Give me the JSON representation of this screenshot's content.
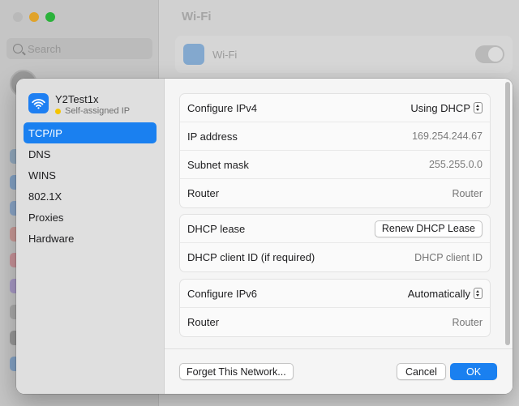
{
  "background": {
    "title": "Wi-Fi",
    "search_placeholder": "Search",
    "wifi_label": "Wi-Fi",
    "wifi_toggle_on": true
  },
  "network": {
    "name": "Y2Test1x",
    "status": "Self-assigned IP",
    "status_color": "#f5c400"
  },
  "tabs": [
    {
      "label": "TCP/IP",
      "selected": true
    },
    {
      "label": "DNS"
    },
    {
      "label": "WINS"
    },
    {
      "label": "802.1X"
    },
    {
      "label": "Proxies"
    },
    {
      "label": "Hardware"
    }
  ],
  "ipv4": {
    "configure_label": "Configure IPv4",
    "configure_value": "Using DHCP",
    "ip_label": "IP address",
    "ip_value": "169.254.244.67",
    "subnet_label": "Subnet mask",
    "subnet_value": "255.255.0.0",
    "router_label": "Router",
    "router_placeholder": "Router"
  },
  "dhcp": {
    "lease_label": "DHCP lease",
    "renew_button": "Renew DHCP Lease",
    "client_id_label": "DHCP client ID (if required)",
    "client_id_placeholder": "DHCP client ID"
  },
  "ipv6": {
    "configure_label": "Configure IPv6",
    "configure_value": "Automatically",
    "router_label": "Router",
    "router_placeholder": "Router"
  },
  "footer": {
    "forget_button": "Forget This Network...",
    "cancel_button": "Cancel",
    "ok_button": "OK"
  },
  "colors": {
    "accent": "#1a80f0"
  }
}
